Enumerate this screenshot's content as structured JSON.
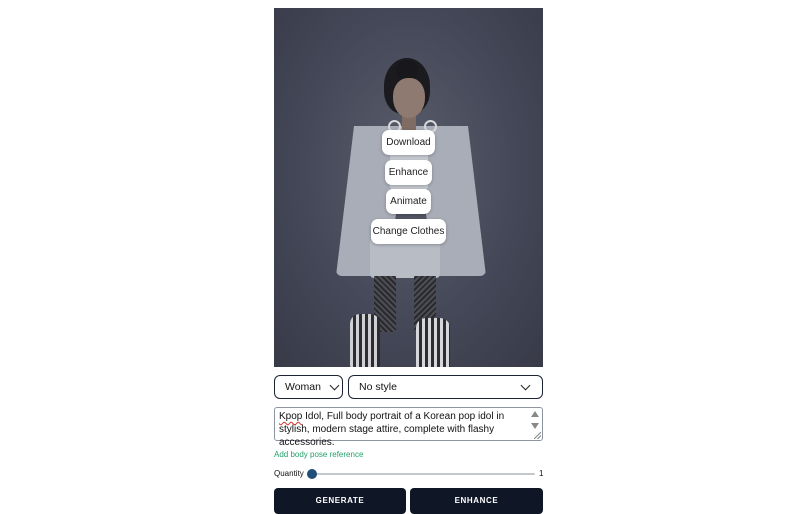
{
  "image_menu": {
    "download_label": "Download",
    "enhance_label": "Enhance",
    "animate_label": "Animate",
    "change_clothes_label": "Change Clothes"
  },
  "controls": {
    "gender_select": {
      "value": "Woman"
    },
    "style_select": {
      "value": "No style"
    }
  },
  "prompt": {
    "first_word": "Kpop",
    "rest_text": " Idol, Full body portrait of a Korean pop idol in stylish, modern stage attire, complete with flashy accessories."
  },
  "add_pose_link": "Add body pose reference",
  "quantity": {
    "label": "Quantity",
    "value": "1",
    "slider_fraction": 0
  },
  "actions": {
    "generate_label": "GENERATE",
    "enhance_label": "ENHANCE"
  },
  "colors": {
    "primary_dark": "#0f1626",
    "link_green": "#22a06b",
    "slider_thumb": "#1f4e79"
  }
}
